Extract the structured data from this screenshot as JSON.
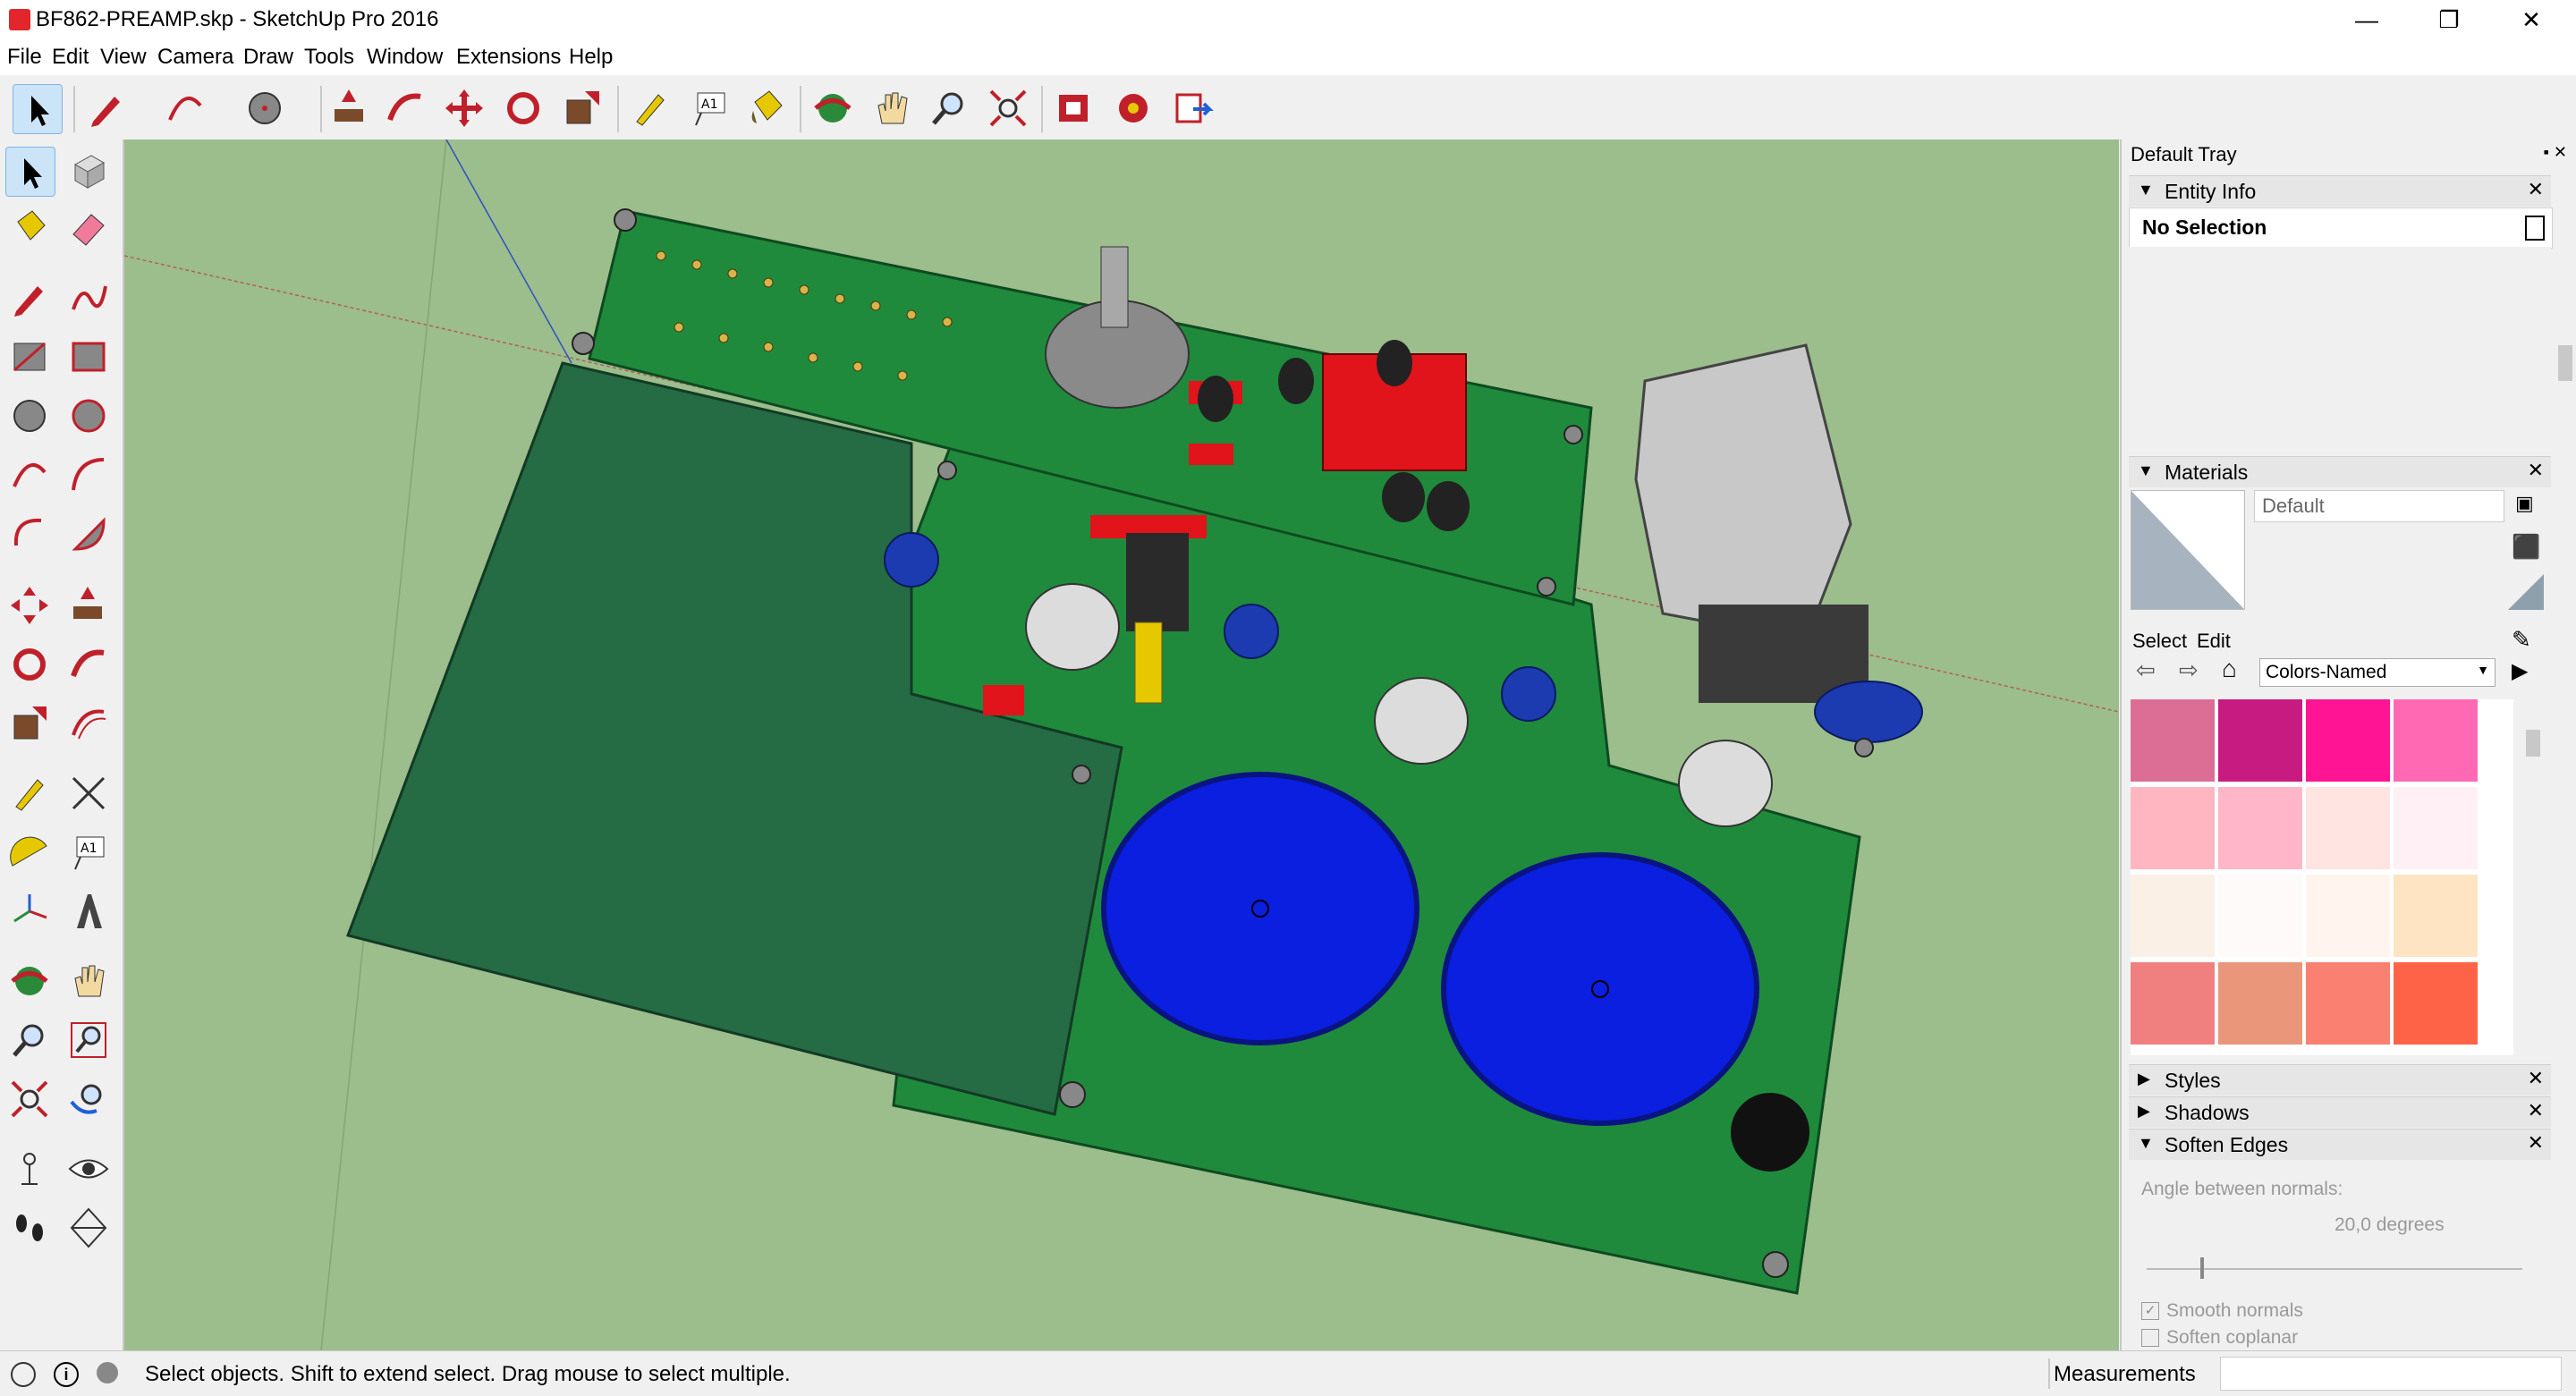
{
  "window": {
    "title": "BF862-PREAMP.skp - SketchUp Pro 2016",
    "min": "—",
    "restore": "❐",
    "close": "✕"
  },
  "menu": [
    "File",
    "Edit",
    "View",
    "Camera",
    "Draw",
    "Tools",
    "Window",
    "Extensions",
    "Help"
  ],
  "tray": {
    "title": "Default Tray",
    "entity_info": {
      "label": "Entity Info",
      "selection": "No Selection"
    },
    "materials": {
      "label": "Materials",
      "name": "Default",
      "tab_select": "Select",
      "tab_edit": "Edit",
      "library": "Colors-Named",
      "swatches": [
        "#dc6e96",
        "#c81b82",
        "#ff1493",
        "#ff69b4",
        "#ffb6c1",
        "#ffb6c8",
        "#ffe4e1",
        "#fff0f5",
        "#faf0e6",
        "#fffafa",
        "#fff5ee",
        "#ffe4c4",
        "#f08080",
        "#e9967a",
        "#fa8072",
        "#ff6347"
      ]
    },
    "styles": "Styles",
    "shadows": "Shadows",
    "soften_edges": {
      "label": "Soften Edges",
      "angle_label": "Angle between normals:",
      "angle_value": "20,0  degrees",
      "smooth_normals": "Smooth normals",
      "soften_coplanar": "Soften coplanar"
    }
  },
  "status": {
    "message": "Select objects. Shift to extend select. Drag mouse to select multiple.",
    "measurements_label": "Measurements"
  }
}
